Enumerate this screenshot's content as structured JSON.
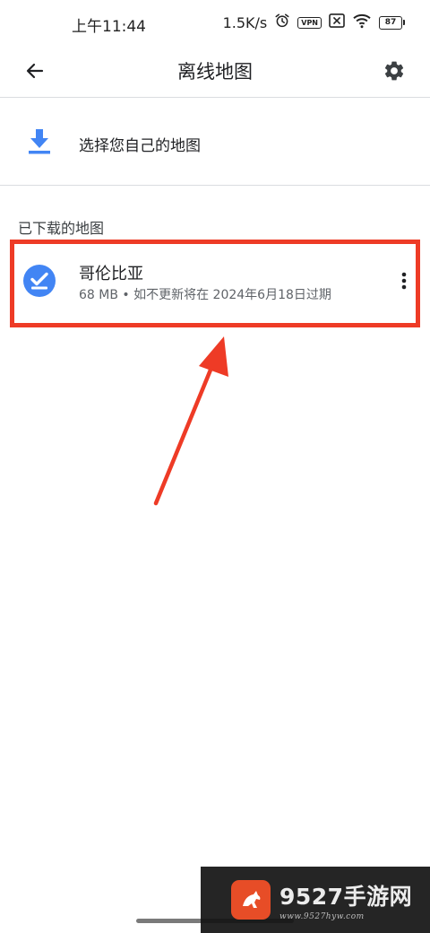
{
  "status_bar": {
    "time": "上午11:44",
    "net_speed": "1.5K/s",
    "vpn_label": "VPN",
    "battery": "87"
  },
  "app_bar": {
    "title": "离线地图",
    "back_icon": "arrow-back-icon",
    "settings_icon": "gear-icon"
  },
  "select_own_map": {
    "label": "选择您自己的地图",
    "icon": "download-icon"
  },
  "downloaded_section": {
    "header": "已下载的地图",
    "items": [
      {
        "name": "哥伦比亚",
        "meta": "68 MB • 如不更新将在 2024年6月18日过期",
        "status_icon": "check-circle-icon",
        "menu_icon": "more-vert-icon"
      }
    ]
  },
  "watermark": {
    "title": "9527手游网",
    "url": "www.9527hyw.com"
  },
  "colors": {
    "accent_blue": "#4285f4",
    "highlight_red": "#ee3b26",
    "divider": "#dadce0",
    "text_primary": "#202124",
    "text_secondary": "#5f6368"
  }
}
